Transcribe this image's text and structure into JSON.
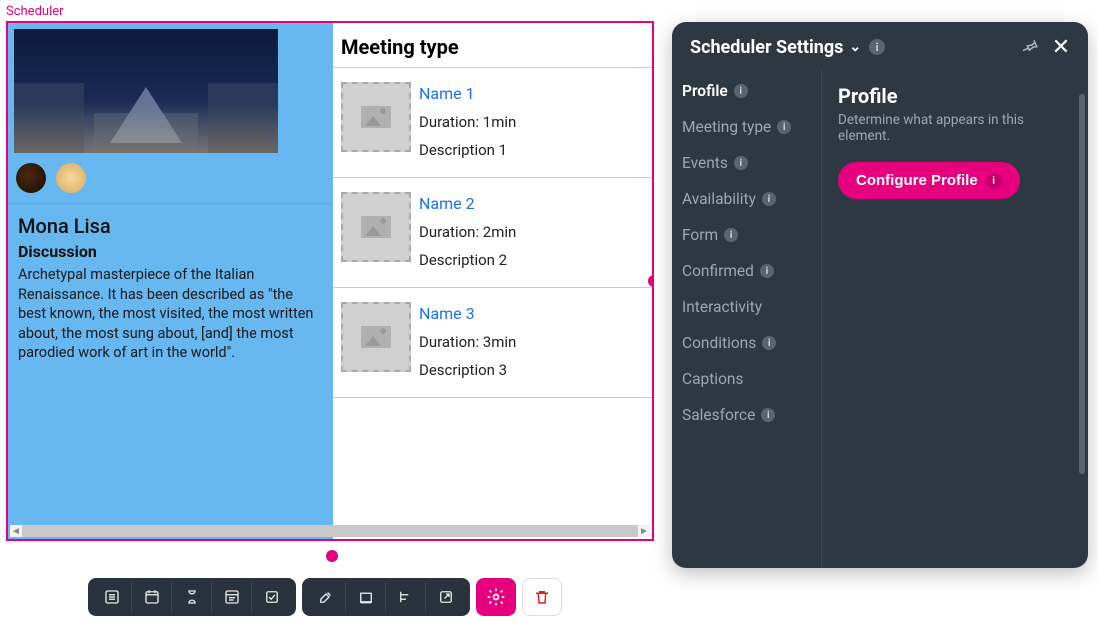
{
  "canvas": {
    "label": "Scheduler",
    "profile": {
      "title": "Mona Lisa",
      "subtitle": "Discussion",
      "description": "Archetypal masterpiece of the Italian Renaissance. It has been described as \"the best known, the most visited, the most written about, the most sung about, [and] the most parodied work of art in the world\"."
    },
    "meeting_header": "Meeting type",
    "meetings": [
      {
        "name": "Name 1",
        "duration": "Duration: 1min",
        "description": "Description 1"
      },
      {
        "name": "Name 2",
        "duration": "Duration: 2min",
        "description": "Description 2"
      },
      {
        "name": "Name 3",
        "duration": "Duration: 3min",
        "description": "Description 3"
      }
    ]
  },
  "toolbar": {
    "icons": [
      "list",
      "calendar",
      "hourglass",
      "panel",
      "checkbox",
      "paint",
      "frame",
      "align-left",
      "open-external"
    ],
    "settings_icon": "gear",
    "trash_icon": "trash"
  },
  "settings": {
    "title": "Scheduler Settings",
    "nav": [
      {
        "label": "Profile",
        "info": true,
        "active": true
      },
      {
        "label": "Meeting type",
        "info": true
      },
      {
        "label": "Events",
        "info": true
      },
      {
        "label": "Availability",
        "info": true
      },
      {
        "label": "Form",
        "info": true
      },
      {
        "label": "Confirmed",
        "info": true
      },
      {
        "label": "Interactivity",
        "info": false
      },
      {
        "label": "Conditions",
        "info": true
      },
      {
        "label": "Captions",
        "info": false
      },
      {
        "label": "Salesforce",
        "info": true
      }
    ],
    "main": {
      "title": "Profile",
      "subtitle": "Determine what appears in this element.",
      "button": "Configure Profile"
    }
  }
}
